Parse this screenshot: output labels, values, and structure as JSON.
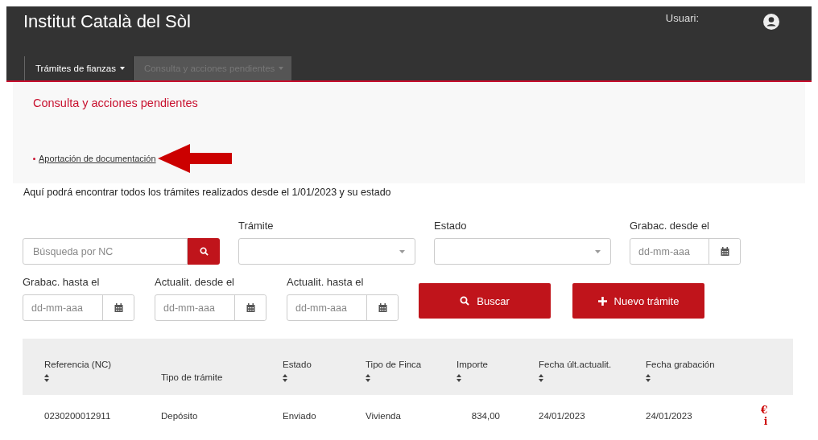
{
  "header": {
    "title": "Institut Català del Sòl",
    "user_label": "Usuari:"
  },
  "tabs": [
    {
      "label": "Trámites de fianzas",
      "selected": true
    },
    {
      "label": "Consulta y acciones pendientes",
      "selected": false
    }
  ],
  "panel": {
    "heading": "Consulta y acciones pendientes",
    "links": [
      "Aportación de documentación"
    ]
  },
  "intro": "Aquí podrá encontrar todos los trámites realizados desde el 1/01/2023 y su estado",
  "filters": [
    {
      "kind": "search",
      "placeholder": "Búsqueda por NC"
    },
    {
      "kind": "select",
      "label": "Trámite"
    },
    {
      "kind": "select",
      "label": "Estado"
    },
    {
      "kind": "date",
      "label": "Grabac. desde el",
      "placeholder": "dd-mm-aaa"
    },
    {
      "kind": "date",
      "label": "Grabac. hasta el",
      "placeholder": "dd-mm-aaa"
    },
    {
      "kind": "date",
      "label": "Actualit. desde el",
      "placeholder": "dd-mm-aaa"
    },
    {
      "kind": "date",
      "label": "Actualit. hasta el",
      "placeholder": "dd-mm-aaa"
    },
    {
      "kind": "submit",
      "label": "Buscar"
    },
    {
      "kind": "create",
      "label": "Nuevo trámite"
    }
  ],
  "table": {
    "columns": [
      {
        "label": "Referencia (NC)",
        "sortable": true
      },
      {
        "label": "Tipo de trámite",
        "sortable": false
      },
      {
        "label": "Estado",
        "sortable": true
      },
      {
        "label": "Tipo de Finca",
        "sortable": true
      },
      {
        "label": "Importe",
        "sortable": true
      },
      {
        "label": "Fecha últ.actualit.",
        "sortable": true
      },
      {
        "label": "Fecha grabación",
        "sortable": true
      }
    ],
    "rows": [
      {
        "cells": [
          "0230200012911",
          "Depósito",
          "Enviado",
          "Vivienda",
          "834,00",
          "24/01/2023",
          "24/01/2023"
        ],
        "actions": [
          "€",
          "i"
        ]
      }
    ]
  }
}
